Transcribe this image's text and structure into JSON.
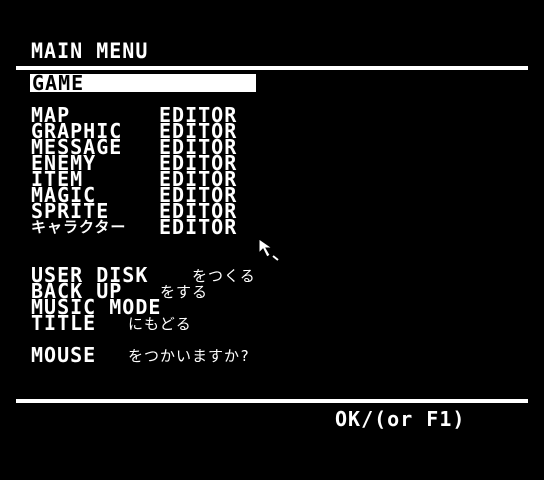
{
  "header": {
    "title": "MAIN MENU"
  },
  "menu": {
    "game": "GAME",
    "editors": [
      {
        "name": "MAP",
        "suffix": "EDITOR"
      },
      {
        "name": "GRAPHIC",
        "suffix": "EDITOR"
      },
      {
        "name": "MESSAGE",
        "suffix": "EDITOR"
      },
      {
        "name": "ENEMY",
        "suffix": "EDITOR"
      },
      {
        "name": "ITEM",
        "suffix": "EDITOR"
      },
      {
        "name": "MAGIC",
        "suffix": "EDITOR"
      },
      {
        "name": "SPRITE",
        "suffix": "EDITOR"
      },
      {
        "name": "キャラクター",
        "suffix": "EDITOR"
      }
    ],
    "utilities": [
      {
        "label": "USER DISK",
        "note": "をつくる"
      },
      {
        "label": "BACK UP",
        "note": "をする"
      },
      {
        "label": "MUSIC MODE",
        "note": ""
      },
      {
        "label": "TITLE",
        "note": "にもどる"
      }
    ],
    "mouse": {
      "label": "MOUSE",
      "note": "をつかいますか?"
    }
  },
  "footer": {
    "ok_label": "OK/(or F1)"
  },
  "icons": {
    "pointer": "mouse-pointer-icon"
  },
  "colors": {
    "background": "#000000",
    "foreground": "#ffffff",
    "selection": "#ffffff"
  }
}
